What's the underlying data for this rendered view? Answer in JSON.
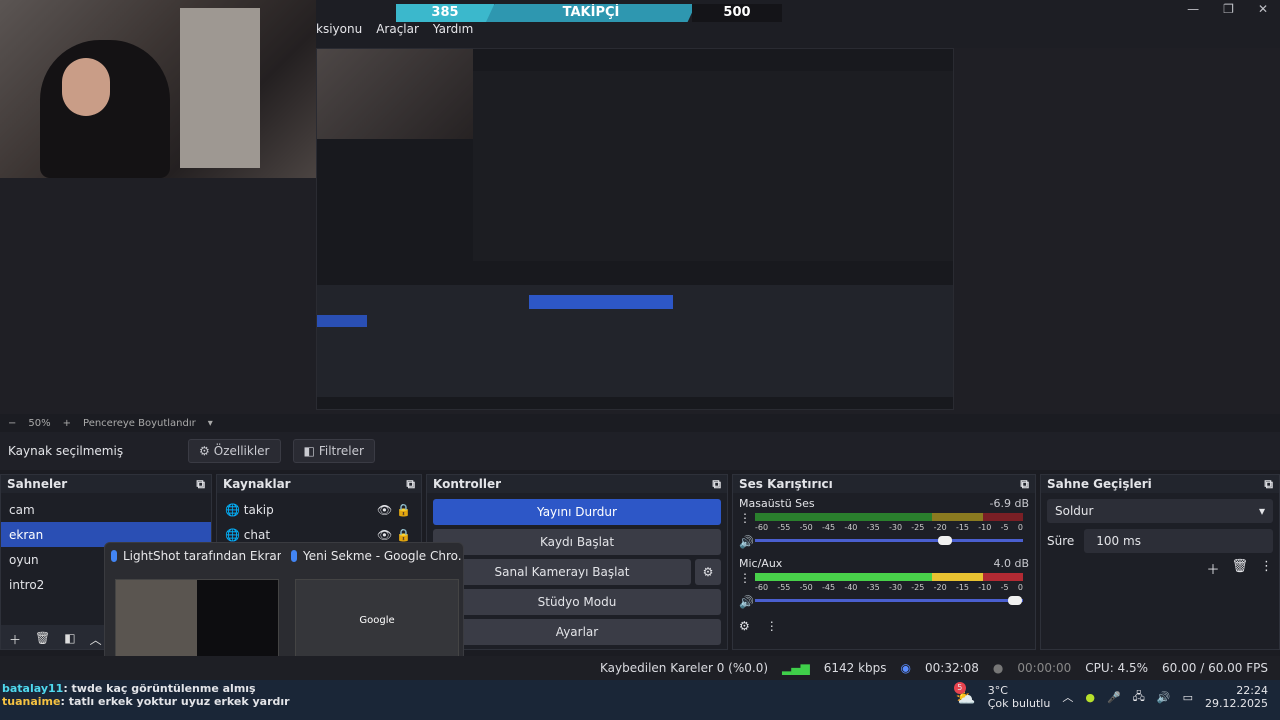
{
  "app": {
    "menus": [
      "ksiyonu",
      "Araçlar",
      "Yardım"
    ],
    "follow_bar": {
      "current": "385",
      "label": "TAKİPÇİ",
      "goal": "500"
    }
  },
  "zoom": {
    "value": "50%",
    "minus": "−",
    "plus": "+",
    "label": "Pencereye Boyutlandır"
  },
  "source_bar": {
    "status": "Kaynak seçilmemiş",
    "properties": "Özellikler",
    "filters": "Filtreler"
  },
  "scenes": {
    "title": "Sahneler",
    "items": [
      "cam",
      "ekran",
      "oyun",
      "intro2"
    ],
    "selected": "ekran"
  },
  "sources": {
    "title": "Kaynaklar",
    "items": [
      "takip",
      "chat"
    ]
  },
  "controls": {
    "title": "Kontroller",
    "stop_stream": "Yayını Durdur",
    "start_recording": "Kaydı Başlat",
    "virtual_camera": "Sanal Kamerayı Başlat",
    "studio_mode": "Stüdyo Modu",
    "settings": "Ayarlar"
  },
  "mixer": {
    "title": "Ses Karıştırıcı",
    "channels": [
      {
        "name": "Masaüstü Ses",
        "db": "-6.9 dB",
        "volume": 0.71
      },
      {
        "name": "Mic/Aux",
        "db": "4.0 dB",
        "volume": 0.97
      }
    ],
    "scale": [
      "-60",
      "-55",
      "-50",
      "-45",
      "-40",
      "-35",
      "-30",
      "-25",
      "-20",
      "-15",
      "-10",
      "-5",
      "0"
    ]
  },
  "transitions": {
    "title": "Sahne Geçişleri",
    "selected": "Soldur",
    "duration_label": "Süre",
    "duration": "100 ms"
  },
  "status": {
    "dropped": "Kaybedilen Kareler 0 (%0.0)",
    "bitrate": "6142 kbps",
    "stream_time": "00:32:08",
    "rec_time": "00:00:00",
    "cpu": "CPU: 4.5%",
    "fps": "60.00 / 60.00 FPS"
  },
  "chrome_tabs": [
    {
      "title": "LightShot tarafından Ekran..."
    },
    {
      "title": "Yeni Sekme - Google Chro..."
    }
  ],
  "chrome_thumb": {
    "google": "Google"
  },
  "chat": [
    {
      "user": "batalay11",
      "text": ": twde kaç görüntülenme almış"
    },
    {
      "user": "tuanaime",
      "text": ": tatlı erkek yoktur uyuz erkek yardır"
    }
  ],
  "tray": {
    "weather_temp": "3°C",
    "weather_text": "Çok bulutlu",
    "time": "22:24",
    "date": "29.12.2025",
    "badge": "5"
  }
}
